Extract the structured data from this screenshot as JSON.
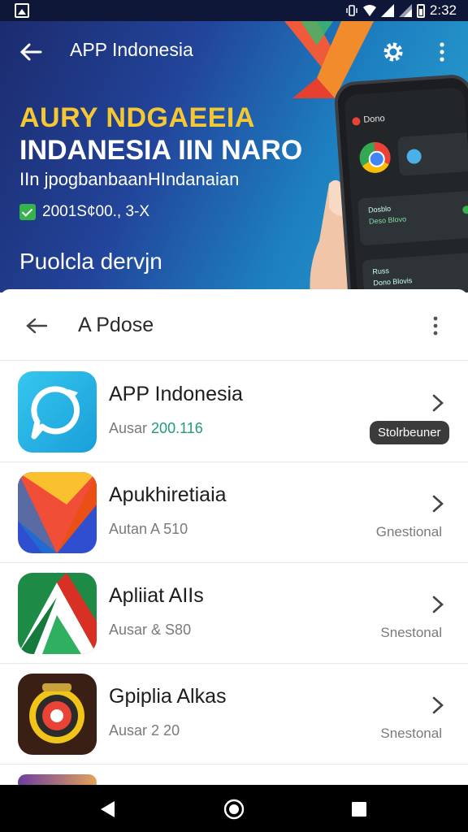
{
  "status_bar": {
    "time": "2:32",
    "icons": [
      "image-icon",
      "vibrate-icon",
      "wifi-icon",
      "signal-icon",
      "signal-icon",
      "battery-icon"
    ]
  },
  "hero": {
    "app_title": "APP Indonesia",
    "headline_1": "AURY NDGAEEIA",
    "headline_2": "INDANESIA IIN NARO",
    "subtitle": "IIn jpogbanbaanHIndanaian",
    "date_text": "2001S¢00., 3-X",
    "cta": "Puolcla dervjn",
    "phone": {
      "header": "Dono",
      "card_1_title": "Dosblo",
      "card_1_sub": "Deso Blovo",
      "card_2_title": "Russ",
      "card_2_sub": "Dono Blovis"
    }
  },
  "sheet": {
    "title": "A Pdose",
    "items": [
      {
        "name": "APP Indonesia",
        "meta_prefix": "Ausar",
        "meta_value": "200.116",
        "tag": "",
        "icon": "chat-sync-icon"
      },
      {
        "name": "Apukhiretiaia",
        "meta_prefix": "Autan A",
        "meta_value": "510",
        "tag": "Gnestional",
        "icon": "play-triangle-icon"
      },
      {
        "name": "Apliiat AIIs",
        "meta_prefix": "Ausar &",
        "meta_value": "S80",
        "tag": "Snestonal",
        "icon": "arrow-a-icon"
      },
      {
        "name": "Gpiplia Alkas",
        "meta_prefix": "Ausar",
        "meta_value": "2 20",
        "tag": "Snestonal",
        "icon": "clock-gadget-icon"
      }
    ],
    "tooltip": "Stolrbeuner"
  },
  "colors": {
    "status_bar": "#0e1738",
    "hero_start": "#1c2b6e",
    "hero_end": "#2aa6cf",
    "headline_yellow": "#f5c833",
    "version_green": "#1f9b7a"
  }
}
